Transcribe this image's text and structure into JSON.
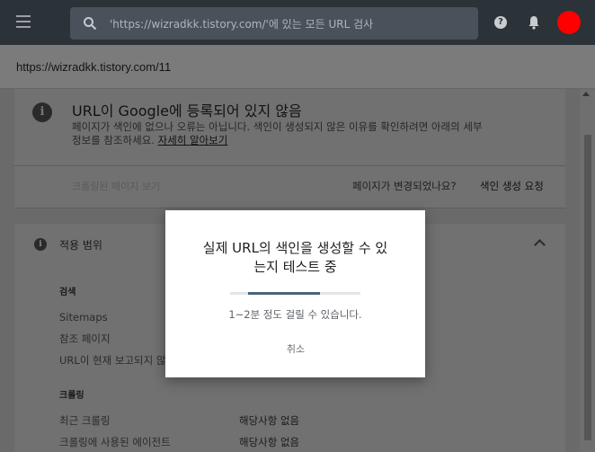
{
  "topbar": {
    "search_placeholder": "'https://wizradkk.tistory.com/'에 있는 모든 URL 검사",
    "help_glyph": "?"
  },
  "url_bar": {
    "url": "https://wizradkk.tistory.com/11"
  },
  "status_card": {
    "title": "URL이 Google에 등록되어 있지 않음",
    "description": "페이지가 색인에 없으나 오류는 아닙니다. 색인이 생성되지 않은 이유를 확인하려면 아래의 세부정보를 참조하세요.",
    "learn_more": "자세히 알아보기",
    "crawled_page_link": "크롤링된 페이지 보기",
    "page_changed_question": "페이지가 변경되었나요?",
    "request_indexing": "색인 생성 요청"
  },
  "coverage": {
    "title": "적용 범위",
    "sections": {
      "search_heading": "검색",
      "sitemaps": "Sitemaps",
      "referring_page": "참조 페이지",
      "url_not_reported": "URL이 현재 보고되지 않음",
      "crawl_heading": "크롤링",
      "last_crawl": "최근 크롤링",
      "last_crawl_value": "해당사항 없음",
      "crawled_as": "크롤링에 사용된 에이전트",
      "crawled_as_value": "해당사항 없음"
    }
  },
  "dialog": {
    "title_line1": "실제 URL의 색인을 생성할 수 있",
    "title_line2": "는지 테스트 중",
    "subtitle": "1~2분 정도 걸릴 수 있습니다.",
    "cancel_label": "취소",
    "progress": 0.64
  },
  "colors": {
    "topbar": "#2b3238",
    "avatar": "#ff0000",
    "progress_fill": "#4a6478"
  },
  "icons": [
    "menu-icon",
    "search-icon",
    "help-icon",
    "bell-icon",
    "info-icon",
    "chevron-up-icon"
  ]
}
